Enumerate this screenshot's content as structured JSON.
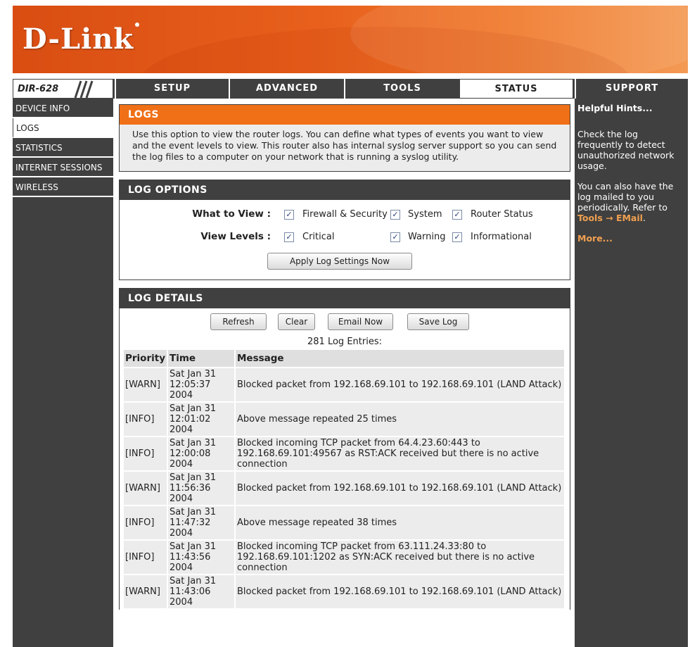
{
  "brand": {
    "logo_text": "D-Link"
  },
  "model": "DIR-628",
  "nav": {
    "tabs": [
      {
        "label": "SETUP"
      },
      {
        "label": "ADVANCED"
      },
      {
        "label": "TOOLS"
      },
      {
        "label": "STATUS",
        "active": true
      },
      {
        "label": "SUPPORT"
      }
    ]
  },
  "sidebar": {
    "items": [
      {
        "label": "DEVICE INFO"
      },
      {
        "label": "LOGS",
        "active": true
      },
      {
        "label": "STATISTICS"
      },
      {
        "label": "INTERNET SESSIONS"
      },
      {
        "label": "WIRELESS"
      }
    ]
  },
  "logs_section": {
    "title": "LOGS",
    "description": "Use this option to view the router logs. You can define what types of events you want to view and the event levels to view. This router also has internal syslog server support so you can send the log files to a computer on your network that is running a syslog utility."
  },
  "log_options": {
    "title": "LOG OPTIONS",
    "what_to_view_label": "What to View :",
    "view_levels_label": "View Levels :",
    "what_to_view": [
      {
        "label": "Firewall & Security",
        "checked": true
      },
      {
        "label": "System",
        "checked": true
      },
      {
        "label": "Router Status",
        "checked": true
      }
    ],
    "view_levels": [
      {
        "label": "Critical",
        "checked": true
      },
      {
        "label": "Warning",
        "checked": true
      },
      {
        "label": "Informational",
        "checked": true
      }
    ],
    "apply_button": "Apply Log Settings Now"
  },
  "log_details": {
    "title": "LOG DETAILS",
    "buttons": {
      "refresh": "Refresh",
      "clear": "Clear",
      "email": "Email Now",
      "save": "Save Log"
    },
    "entries_count": "281 Log Entries:",
    "columns": [
      "Priority",
      "Time",
      "Message"
    ],
    "rows": [
      {
        "priority": "[WARN]",
        "time": [
          "Sat Jan 31",
          "12:05:37",
          "2004"
        ],
        "message": "Blocked packet from 192.168.69.101 to 192.168.69.101 (LAND Attack)"
      },
      {
        "priority": "[INFO]",
        "time": [
          "Sat Jan 31",
          "12:01:02",
          "2004"
        ],
        "message": "Above message repeated 25 times"
      },
      {
        "priority": "[INFO]",
        "time": [
          "Sat Jan 31",
          "12:00:08",
          "2004"
        ],
        "message": "Blocked incoming TCP packet from 64.4.23.60:443 to 192.168.69.101:49567 as RST:ACK received but there is no active connection"
      },
      {
        "priority": "[WARN]",
        "time": [
          "Sat Jan 31",
          "11:56:36",
          "2004"
        ],
        "message": "Blocked packet from 192.168.69.101 to 192.168.69.101 (LAND Attack)"
      },
      {
        "priority": "[INFO]",
        "time": [
          "Sat Jan 31",
          "11:47:32",
          "2004"
        ],
        "message": "Above message repeated 38 times"
      },
      {
        "priority": "[INFO]",
        "time": [
          "Sat Jan 31",
          "11:43:56",
          "2004"
        ],
        "message": "Blocked incoming TCP packet from 63.111.24.33:80 to 192.168.69.101:1202 as SYN:ACK received but there is no active connection"
      },
      {
        "priority": "[WARN]",
        "time": [
          "Sat Jan 31",
          "11:43:06",
          "2004"
        ],
        "message": "Blocked packet from 192.168.69.101 to 192.168.69.101 (LAND Attack)"
      }
    ]
  },
  "hints": {
    "title": "Helpful Hints...",
    "p1": "Check the log frequently to detect unauthorized network usage.",
    "p2": "You can also have the log mailed to you periodically. Refer to",
    "p2_link": "Tools → EMail",
    "p2_end": ".",
    "more": "More..."
  },
  "colors": {
    "orange": "#f07017",
    "dark": "#404040",
    "light_gray": "#ececec"
  }
}
